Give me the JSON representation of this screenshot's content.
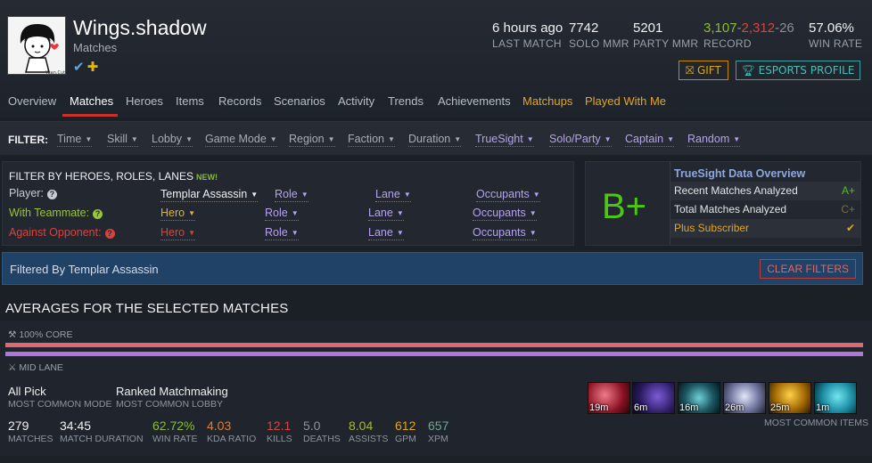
{
  "player": {
    "name": "Wings.shadow",
    "subtitle": "Matches"
  },
  "header_stats": {
    "last_match": {
      "value": "6 hours ago",
      "label": "LAST MATCH"
    },
    "solo_mmr": {
      "value": "7742",
      "label": "SOLO MMR"
    },
    "party_mmr": {
      "value": "5201",
      "label": "PARTY MMR"
    },
    "record": {
      "wins": "3,107",
      "losses": "2,312",
      "abandons": "26",
      "sep": "-",
      "label": "RECORD"
    },
    "win_rate": {
      "value": "57.06%",
      "label": "WIN RATE"
    }
  },
  "buttons": {
    "gift": "GIFT",
    "esports": "ESPORTS PROFILE",
    "clear": "CLEAR FILTERS"
  },
  "nav": {
    "tabs": [
      "Overview",
      "Matches",
      "Heroes",
      "Items",
      "Records",
      "Scenarios",
      "Activity",
      "Trends",
      "Achievements",
      "Matchups",
      "Played With Me"
    ],
    "active": "Matches"
  },
  "filter_bar": {
    "label": "FILTER:",
    "items": [
      "Time",
      "Skill",
      "Lobby",
      "Game Mode",
      "Region",
      "Faction",
      "Duration",
      "TrueSight",
      "Solo/Party",
      "Captain",
      "Random"
    ]
  },
  "hero_filter": {
    "title": "FILTER BY HEROES, ROLES, LANES",
    "new_badge": "NEW!",
    "rows": [
      {
        "label": "Player:",
        "hero": "Templar Assassin",
        "role": "Role",
        "lane": "Lane",
        "occupants": "Occupants"
      },
      {
        "label": "With Teammate:",
        "hero": "Hero",
        "role": "Role",
        "lane": "Lane",
        "occupants": "Occupants"
      },
      {
        "label": "Against Opponent:",
        "hero": "Hero",
        "role": "Role",
        "lane": "Lane",
        "occupants": "Occupants"
      }
    ]
  },
  "truesight": {
    "grade": "B+",
    "title": "TrueSight Data Overview",
    "rows": [
      {
        "label": "Recent Matches Analyzed",
        "grade": "A+"
      },
      {
        "label": "Total Matches Analyzed",
        "grade": "C+"
      },
      {
        "label": "Plus Subscriber",
        "grade": "✔"
      }
    ]
  },
  "filtered_by": "Filtered By Templar Assassin",
  "averages": {
    "title": "AVERAGES FOR THE SELECTED MATCHES",
    "core_label": "100% CORE",
    "lane_label": "MID LANE",
    "mode": {
      "value": "All Pick",
      "label": "MOST COMMON MODE"
    },
    "lobby": {
      "value": "Ranked Matchmaking",
      "label": "MOST COMMON LOBBY"
    },
    "stats": [
      {
        "value": "279",
        "label": "MATCHES"
      },
      {
        "value": "34:45",
        "label": "MATCH DURATION"
      },
      {
        "value": "62.72%",
        "label": "WIN RATE"
      },
      {
        "value": "4.03",
        "label": "KDA RATIO"
      },
      {
        "value": "12.1",
        "label": "KILLS"
      },
      {
        "value": "5.0",
        "label": "DEATHS"
      },
      {
        "value": "8.04",
        "label": "ASSISTS"
      },
      {
        "value": "612",
        "label": "GPM"
      },
      {
        "value": "657",
        "label": "XPM"
      }
    ],
    "items": [
      {
        "name": "dragon-lance-icon",
        "time": "19m"
      },
      {
        "name": "power-treads-icon",
        "time": "6m"
      },
      {
        "name": "desolator-icon",
        "time": "16m"
      },
      {
        "name": "black-king-bar-icon",
        "time": "26m"
      },
      {
        "name": "butterfly-icon",
        "time": "25m"
      },
      {
        "name": "blink-dagger-icon",
        "time": "1m"
      }
    ],
    "items_label": "MOST COMMON ITEMS"
  }
}
